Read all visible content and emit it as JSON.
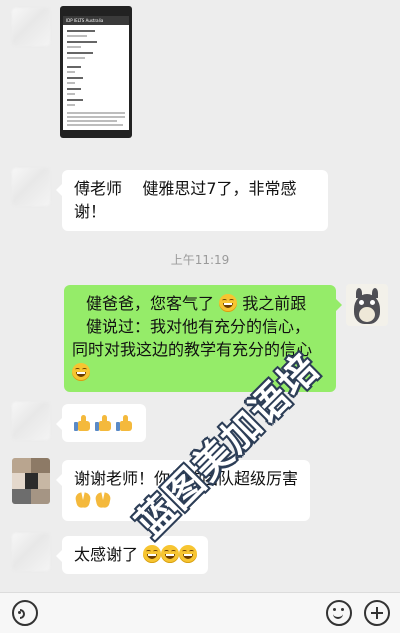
{
  "thumbnail": {
    "header": "IDP IELTS Australia"
  },
  "messages": {
    "m1": {
      "sender": "傅老师",
      "text": "健雅思过7了，非常感谢！"
    },
    "timestamp": "上午11:19",
    "m2": {
      "line1": "健爸爸，您客气了",
      "line1b": "我之前跟",
      "line2": "健说过：我对他有充分的信心，",
      "line3": "同时对我这边的教学有充分的信心"
    },
    "m3": {
      "emoji": [
        "thumbs-up",
        "thumbs-up",
        "thumbs-up"
      ]
    },
    "m4": {
      "text": "谢谢老师！你们的团队超级厉害",
      "emoji": [
        "folded-hands",
        "folded-hands"
      ]
    },
    "m5": {
      "text": "太感谢了",
      "emoji": [
        "grin",
        "grin",
        "grin"
      ]
    }
  },
  "watermark": "蓝图美加语培",
  "colors": {
    "bubble_self": "#95ec69",
    "bubble_other": "#ffffff",
    "background": "#ededed"
  },
  "icons": {
    "voice": "voice-icon",
    "emoji": "emoji-icon",
    "more": "plus-icon"
  }
}
